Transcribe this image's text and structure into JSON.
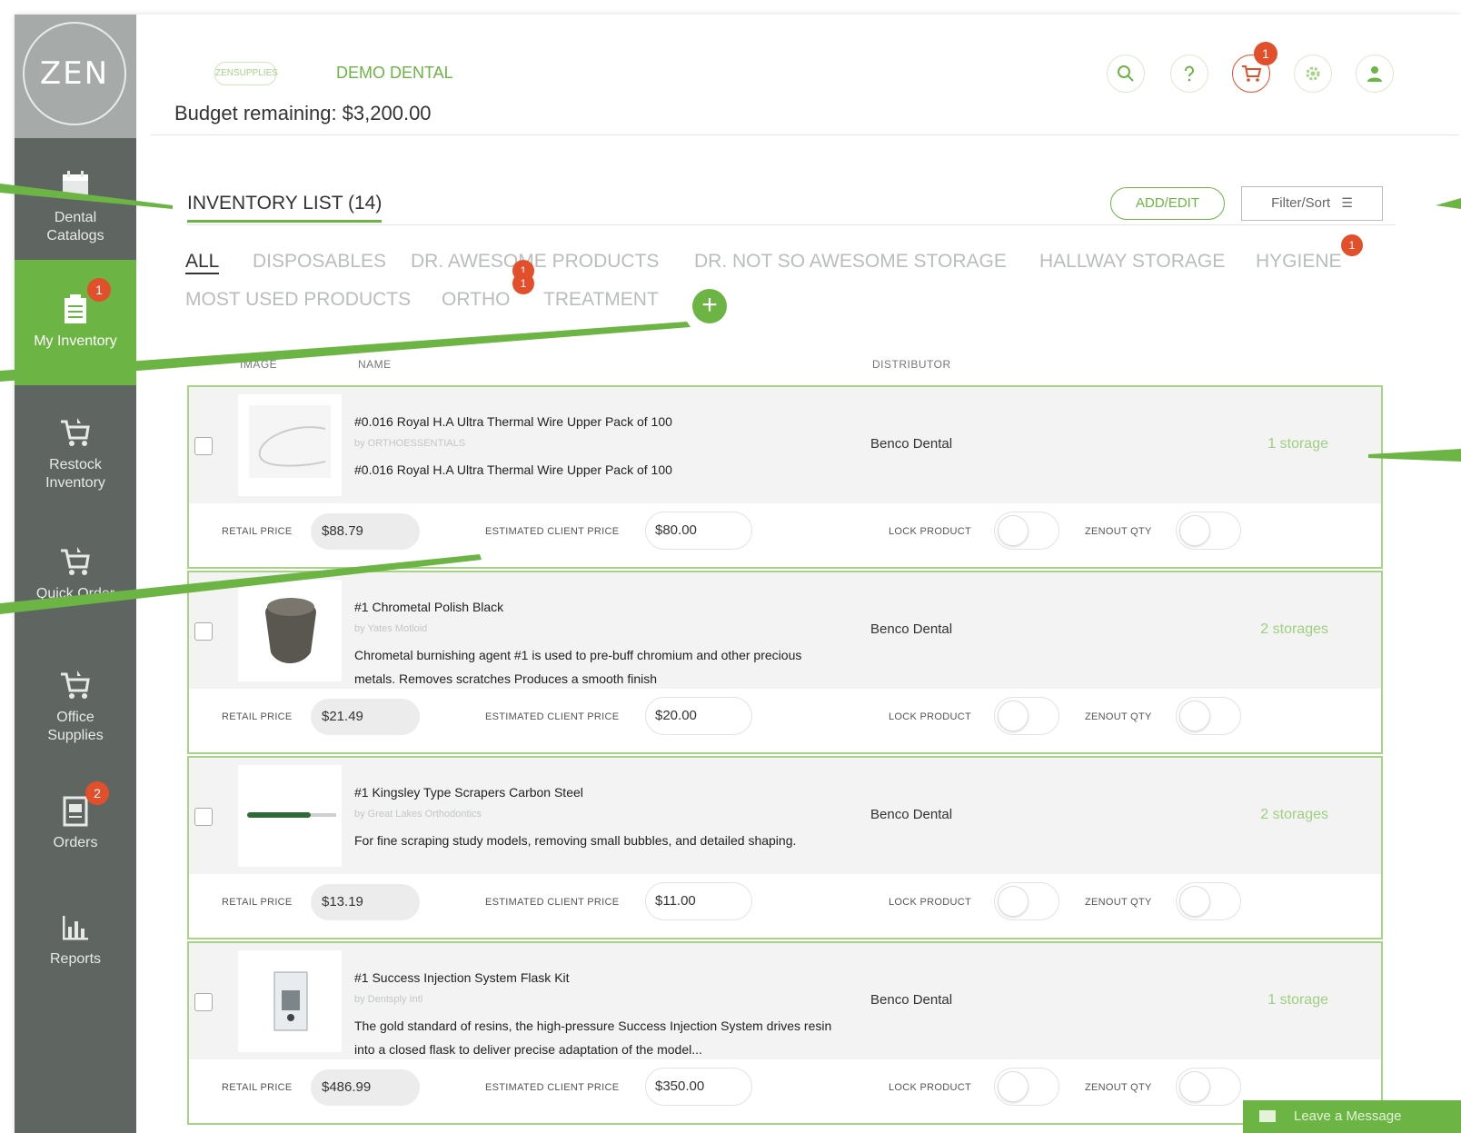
{
  "sidebar": {
    "logo": "ZEN",
    "items": [
      {
        "label_l1": "Dental",
        "label_l2": "Catalogs",
        "icon": "calendar-icon"
      },
      {
        "label_l1": "My Inventory",
        "label_l2": "",
        "icon": "clipboard-icon",
        "badge": "1"
      },
      {
        "label_l1": "Restock",
        "label_l2": "Inventory",
        "icon": "cart-icon"
      },
      {
        "label_l1": "Quick Order",
        "label_l2": "",
        "icon": "cart-icon"
      },
      {
        "label_l1": "Office",
        "label_l2": "Supplies",
        "icon": "cart-icon"
      },
      {
        "label_l1": "Orders",
        "label_l2": "",
        "icon": "document-icon",
        "badge": "2"
      },
      {
        "label_l1": "Reports",
        "label_l2": "",
        "icon": "bar-chart-icon"
      }
    ]
  },
  "header": {
    "brand_mini": "ZENSUPPLIES",
    "practice_name": "DEMO DENTAL",
    "budget": "Budget remaining: $3,200.00",
    "cart_badge": "1",
    "icons": [
      "search-icon",
      "help-icon",
      "cart-icon",
      "settings-icon",
      "user-icon"
    ]
  },
  "inventory": {
    "title": "INVENTORY LIST (14)",
    "add_edit_label": "ADD/EDIT",
    "filter_label": "Filter/Sort",
    "tabs": [
      {
        "label": "ALL"
      },
      {
        "label": "DISPOSABLES"
      },
      {
        "label": "DR. AWESOME PRODUCTS",
        "badge": "1"
      },
      {
        "label": "DR. NOT SO AWESOME STORAGE"
      },
      {
        "label": "HALLWAY STORAGE"
      },
      {
        "label": "HYGIENE",
        "badge": "1"
      },
      {
        "label": "MOST USED PRODUCTS"
      },
      {
        "label": "ORTHO",
        "badge": "1"
      },
      {
        "label": "TREATMENT"
      }
    ],
    "add_category": "+",
    "columns": {
      "image": "IMAGE",
      "name": "NAME",
      "distributor": "DISTRIBUTOR"
    },
    "field_labels": {
      "retail": "RETAIL PRICE",
      "estimated": "ESTIMATED CLIENT PRICE",
      "lock": "LOCK PRODUCT",
      "zenout": "ZENOUT QTY"
    },
    "products": [
      {
        "name": "#0.016 Royal H.A Ultra Thermal Wire Upper Pack of 100",
        "by": "by ORTHOESSENTIALS",
        "desc": "#0.016 Royal H.A Ultra Thermal Wire Upper Pack of 100",
        "distributor": "Benco Dental",
        "storage": "1 storage",
        "retail_price": "$88.79",
        "client_price": "$80.00",
        "lock": false,
        "zenout": false
      },
      {
        "name": "#1 Chrometal Polish Black",
        "by": "by Yates Motloid",
        "desc": "Chrometal burnishing agent #1 is used to pre-buff chromium and other precious metals. Removes scratches Produces a smooth finish",
        "distributor": "Benco Dental",
        "storage": "2 storages",
        "retail_price": "$21.49",
        "client_price": "$20.00",
        "lock": false,
        "zenout": false
      },
      {
        "name": "#1 Kingsley Type Scrapers Carbon Steel",
        "by": "by Great Lakes Orthodontics",
        "desc": "For fine scraping study models, removing small bubbles, and detailed shaping.",
        "distributor": "Benco Dental",
        "storage": "2 storages",
        "retail_price": "$13.19",
        "client_price": "$11.00",
        "lock": false,
        "zenout": false
      },
      {
        "name": "#1 Success Injection System Flask Kit",
        "by": "by Dentsply Intl",
        "desc": "The gold standard of resins, the high-pressure Success Injection System drives resin into a closed flask to deliver precise adaptation of the model...",
        "distributor": "Benco Dental",
        "storage": "1 storage",
        "retail_price": "$486.99",
        "client_price": "$350.00",
        "lock": false,
        "zenout": false
      }
    ]
  },
  "chat": {
    "label": "Leave a Message"
  },
  "colors": {
    "brand_green": "#6cb544",
    "sidebar": "#5f6662",
    "badge_red": "#e2502b"
  }
}
